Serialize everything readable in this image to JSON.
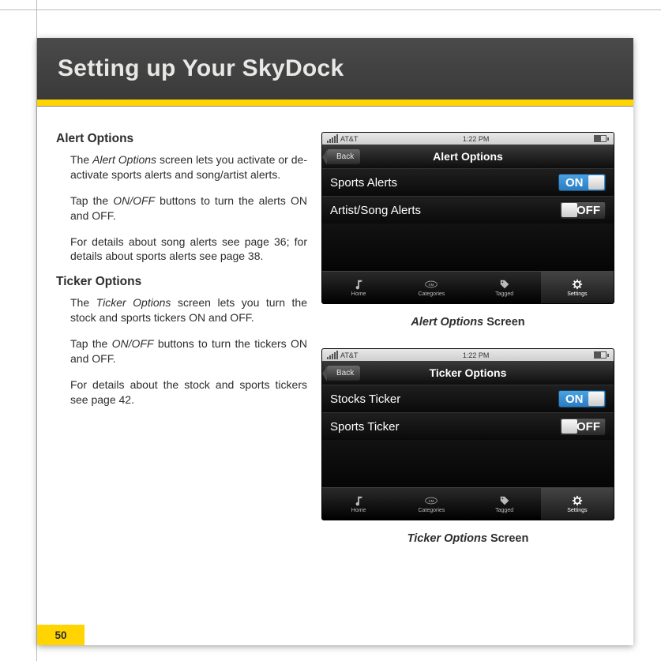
{
  "page": {
    "title": "Setting up Your SkyDock",
    "number": "50"
  },
  "sections": {
    "alert": {
      "heading": "Alert Options",
      "p1a": "The ",
      "p1b": "Alert Options",
      "p1c": " screen lets you activate or de-activate sports alerts and song/artist alerts.",
      "p2a": "Tap the ",
      "p2b": "ON/OFF",
      "p2c": " buttons to turn the alerts ON and OFF.",
      "p3": "For details about song alerts see page 36; for details about sports alerts see page 38."
    },
    "ticker": {
      "heading": "Ticker Options",
      "p1a": "The ",
      "p1b": "Ticker Options",
      "p1c": " screen lets you turn the stock and sports tickers ON and OFF.",
      "p2a": "Tap the ",
      "p2b": "ON/OFF",
      "p2c": " buttons to turn the tickers ON and OFF.",
      "p3": "For details about the stock and sports tickers see page 42."
    }
  },
  "statusbar": {
    "carrier": "AT&T",
    "time": "1:22 PM"
  },
  "screens": {
    "alert": {
      "back": "Back",
      "title": "Alert Options",
      "rows": [
        {
          "label": "Sports Alerts",
          "state": "ON"
        },
        {
          "label": "Artist/Song Alerts",
          "state": "OFF"
        }
      ],
      "caption_i": "Alert Options",
      "caption_b": " Screen"
    },
    "ticker": {
      "back": "Back",
      "title": "Ticker Options",
      "rows": [
        {
          "label": "Stocks Ticker",
          "state": "ON"
        },
        {
          "label": "Sports Ticker",
          "state": "OFF"
        }
      ],
      "caption_i": "Ticker Options",
      "caption_b": " Screen"
    }
  },
  "tabs": [
    {
      "label": "Home"
    },
    {
      "label": "Categories"
    },
    {
      "label": "Tagged"
    },
    {
      "label": "Settings"
    }
  ]
}
